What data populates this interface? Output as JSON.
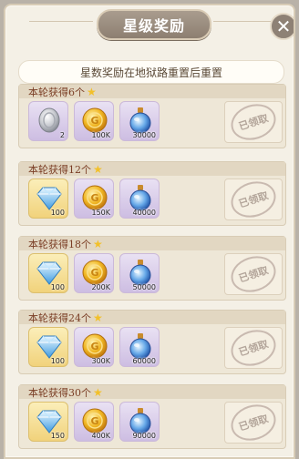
{
  "title": "星级奖励",
  "close_label": "✕",
  "notice": "星数奖励在地狱路重置后重置",
  "claimed_label": "已领取",
  "tiers": [
    {
      "label": "本轮获得6个",
      "items": [
        {
          "kind": "silver-coin",
          "qty": "2"
        },
        {
          "kind": "gold-coin",
          "qty": "100K"
        },
        {
          "kind": "potion",
          "qty": "30000"
        }
      ]
    },
    {
      "label": "本轮获得12个",
      "items": [
        {
          "kind": "diamond",
          "qty": "100"
        },
        {
          "kind": "gold-coin",
          "qty": "150K"
        },
        {
          "kind": "potion",
          "qty": "40000"
        }
      ]
    },
    {
      "label": "本轮获得18个",
      "items": [
        {
          "kind": "diamond",
          "qty": "100"
        },
        {
          "kind": "gold-coin",
          "qty": "200K"
        },
        {
          "kind": "potion",
          "qty": "50000"
        }
      ]
    },
    {
      "label": "本轮获得24个",
      "items": [
        {
          "kind": "diamond",
          "qty": "100"
        },
        {
          "kind": "gold-coin",
          "qty": "300K"
        },
        {
          "kind": "potion",
          "qty": "60000"
        }
      ]
    },
    {
      "label": "本轮获得30个",
      "items": [
        {
          "kind": "diamond",
          "qty": "150"
        },
        {
          "kind": "gold-coin",
          "qty": "400K"
        },
        {
          "kind": "potion",
          "qty": "90000"
        }
      ]
    }
  ]
}
